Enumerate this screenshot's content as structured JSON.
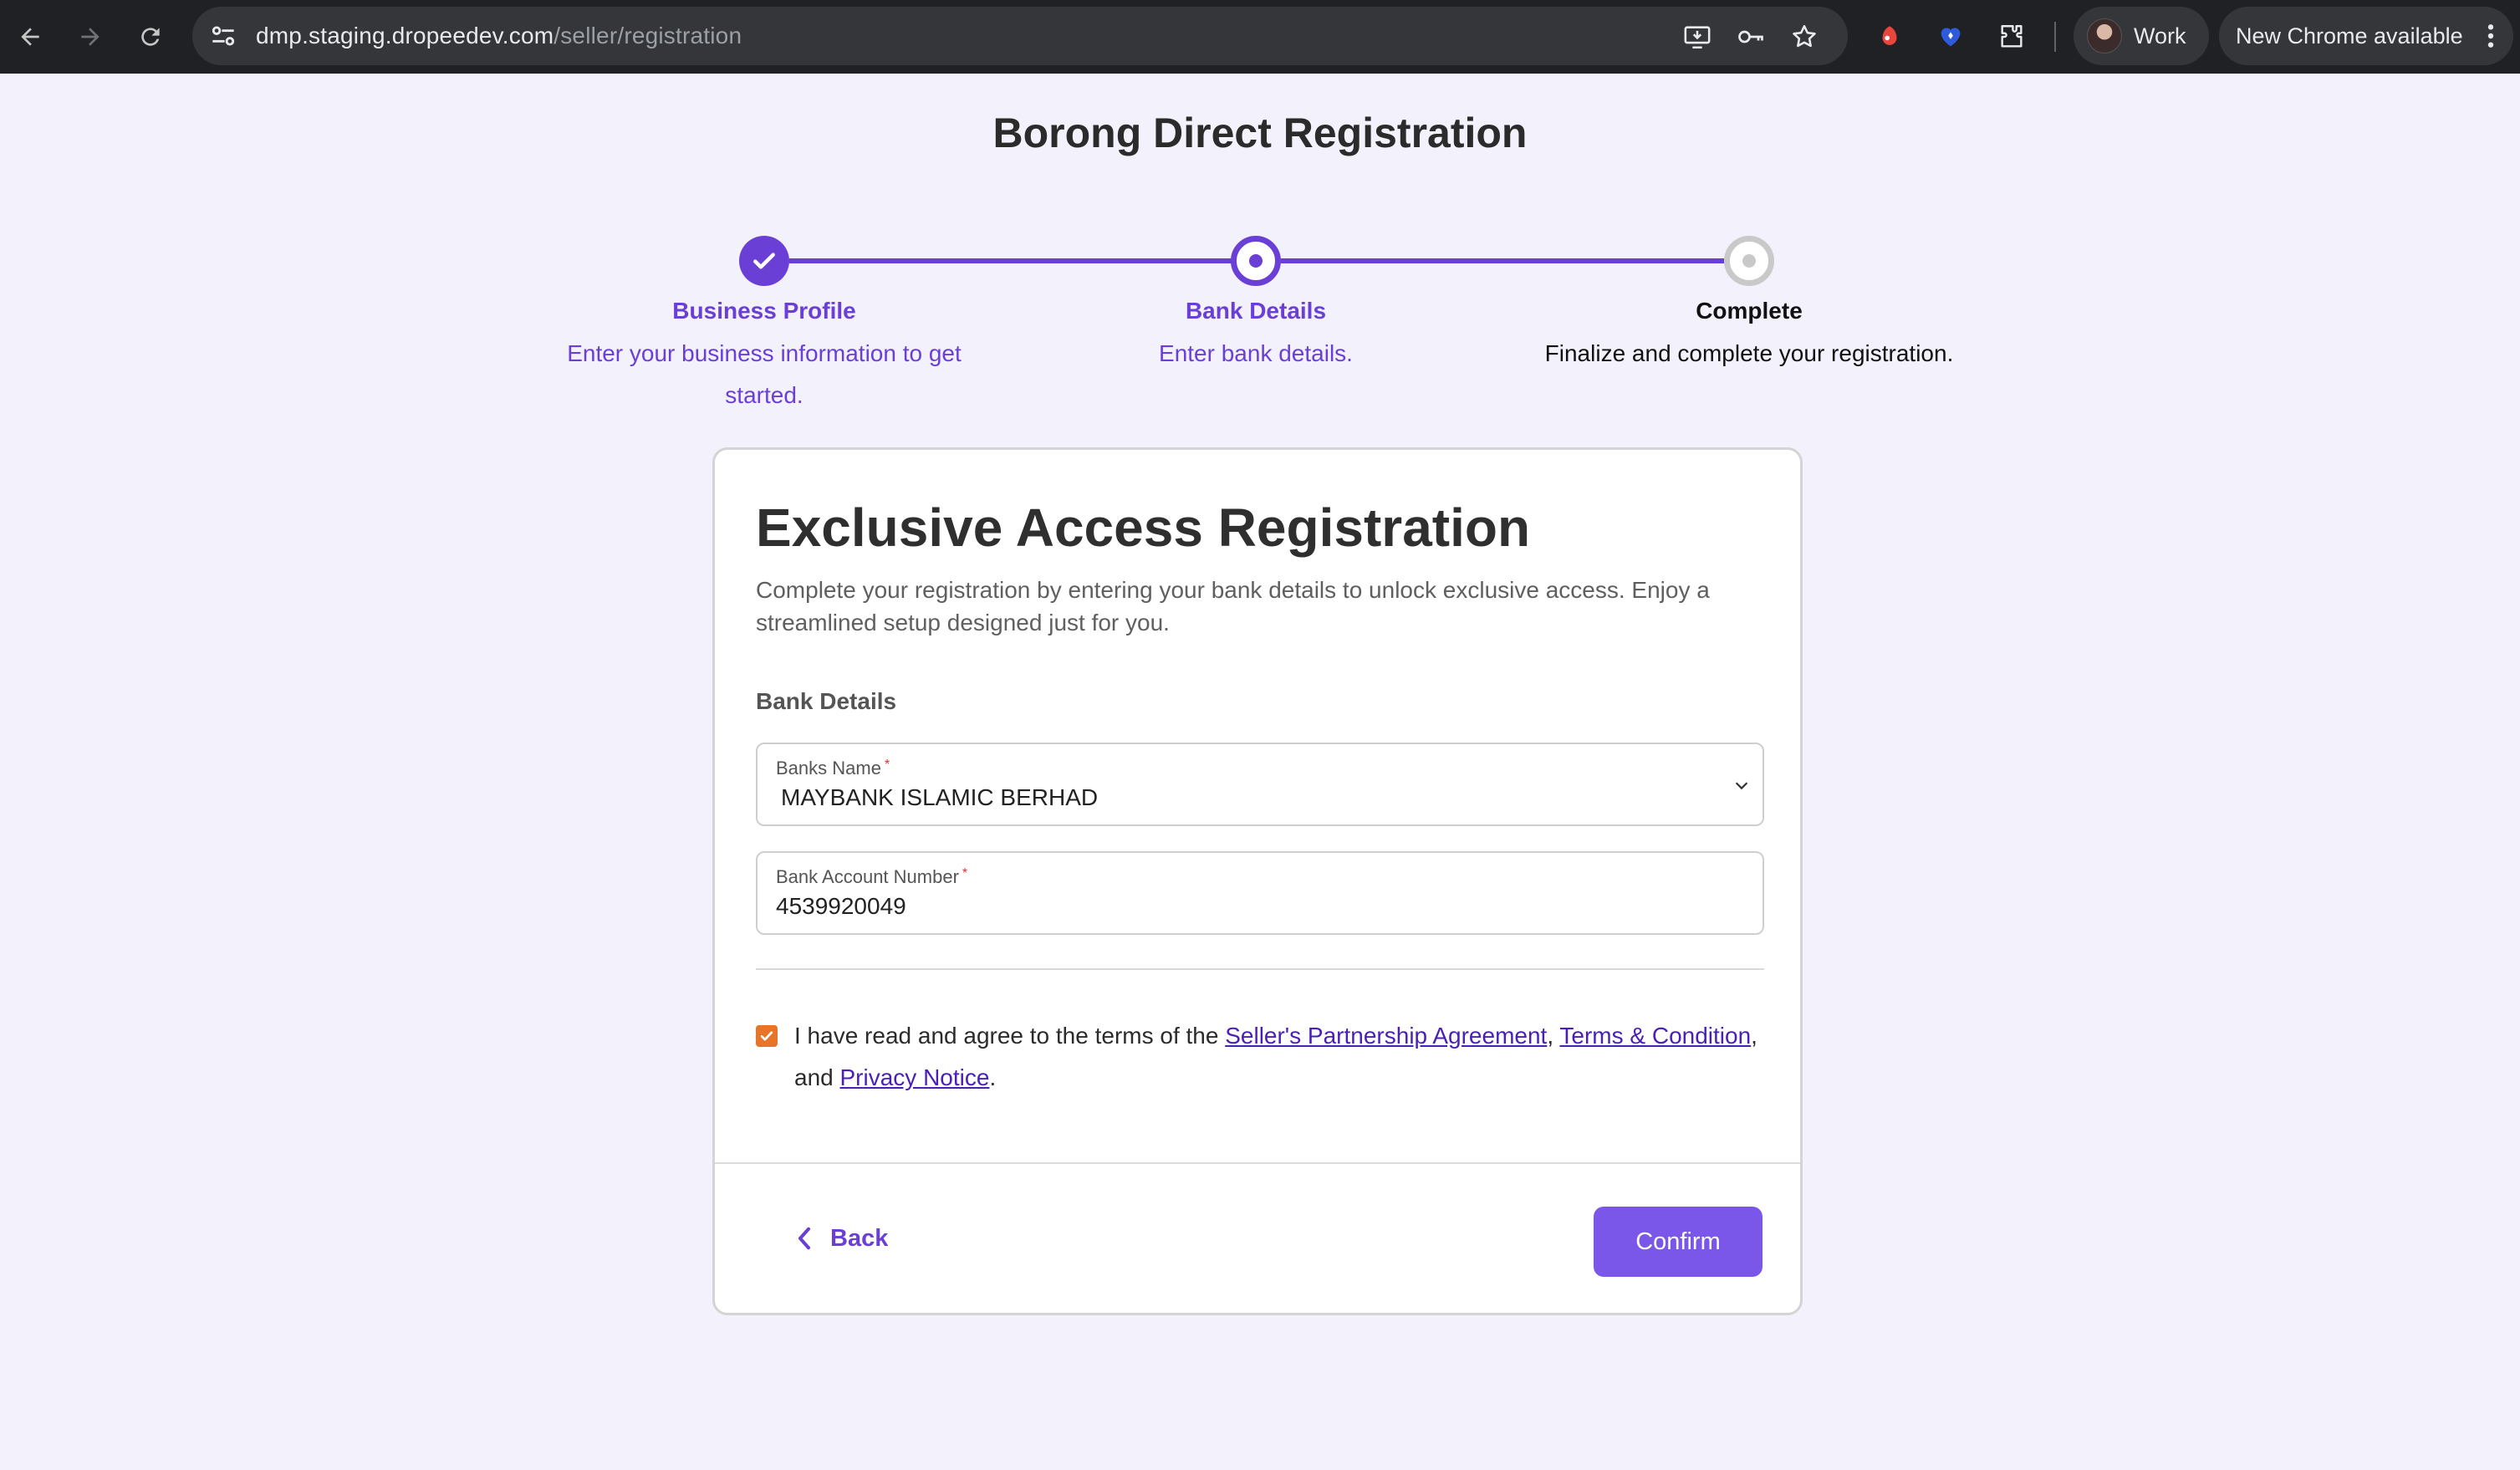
{
  "browser": {
    "url_host": "dmp.staging.dropeedev.com",
    "url_path": "/seller/registration",
    "profile_label": "Work",
    "update_label": "New Chrome available"
  },
  "page": {
    "title": "Borong Direct Registration"
  },
  "steps": [
    {
      "title": "Business Profile",
      "description": "Enter your business information to get started.",
      "status": "completed"
    },
    {
      "title": "Bank Details",
      "description": "Enter bank details.",
      "status": "active"
    },
    {
      "title": "Complete",
      "description": "Finalize and complete your registration.",
      "status": "pending"
    }
  ],
  "card": {
    "heading": "Exclusive Access Registration",
    "lead": "Complete your registration by entering your bank details to unlock exclusive access. Enjoy a streamlined setup designed just for you.",
    "section_label": "Bank Details",
    "bank_name_label": "Banks Name",
    "bank_name_value": "MAYBANK ISLAMIC BERHAD",
    "account_label": "Bank Account Number",
    "account_value": "4539920049",
    "required_mark": "*",
    "agree_prefix": "I have read and agree to the terms of the ",
    "link_spa": "Seller's Partnership Agreement",
    "sep_comma": ", ",
    "link_tc": "Terms & Condition",
    "agree_and": ", and ",
    "link_privacy": "Privacy Notice",
    "agree_end": ".",
    "agree_checked": true,
    "back_label": "Back",
    "confirm_label": "Confirm"
  },
  "colors": {
    "accent": "#6a3fd6",
    "button": "#7a57e8",
    "checkbox": "#e8742a",
    "background": "#f3f1fc"
  },
  "icons": [
    "back-arrow-icon",
    "forward-arrow-icon",
    "reload-icon",
    "site-settings-icon",
    "install-app-icon",
    "password-key-icon",
    "bookmark-star-icon",
    "extension-red-icon",
    "extension-heart-icon",
    "extensions-puzzle-icon",
    "more-vert-icon",
    "check-icon",
    "chevron-down-icon",
    "chevron-left-icon"
  ]
}
